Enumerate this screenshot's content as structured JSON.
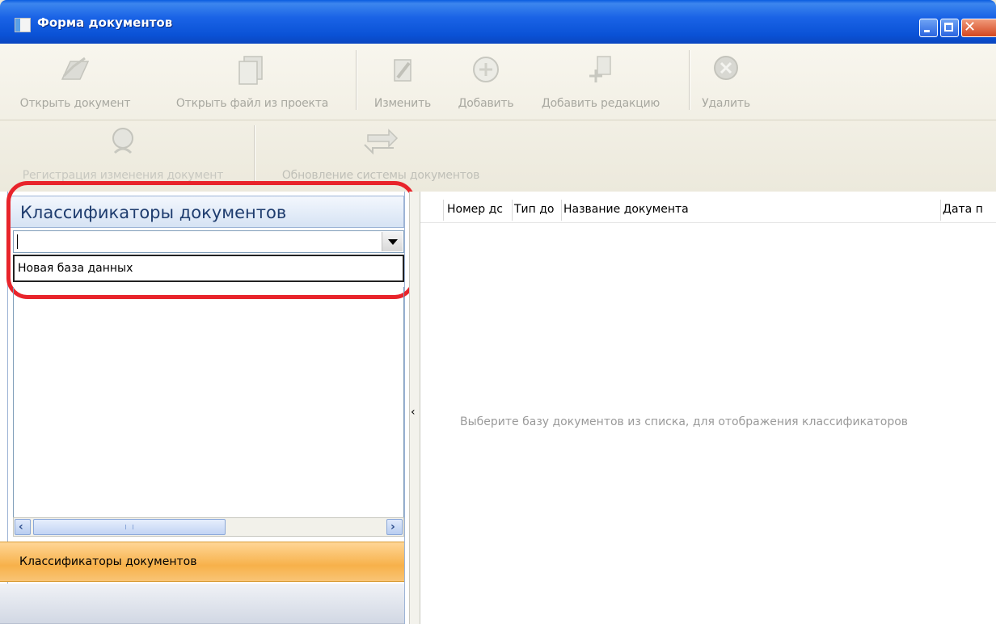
{
  "window": {
    "title": "Форма документов",
    "controls": [
      "minimize",
      "maximize",
      "close"
    ]
  },
  "toolbar": {
    "row1": [
      {
        "label": "Открыть документ",
        "icon": "open-document-icon"
      },
      {
        "label": "Открыть файл из проекта",
        "icon": "open-file-from-project-icon"
      },
      {
        "label": "Изменить",
        "icon": "edit-icon"
      },
      {
        "label": "Добавить",
        "icon": "add-icon"
      },
      {
        "label": "Добавить редакцию",
        "icon": "add-revision-icon"
      },
      {
        "label": "Удалить",
        "icon": "delete-icon"
      }
    ],
    "row2": [
      {
        "label": "Регистрация изменения документ",
        "icon": "register-change-icon"
      },
      {
        "label": "Обновление системы документов",
        "icon": "refresh-system-icon"
      }
    ]
  },
  "left_panel": {
    "header": "Классификаторы документов",
    "database_combo": {
      "value": ""
    },
    "dropdown_option": "Новая база данных",
    "nav_active": "Классификаторы документов"
  },
  "right_panel": {
    "columns": [
      "Номер дс",
      "Тип до",
      "Название документа",
      "Дата п"
    ],
    "empty_message": "Выберите базу документов из списка, для отображения классификаторов"
  },
  "colors": {
    "highlight": "#e8242b",
    "nav_active": "#f7b14a",
    "titlebar": "#0a52d6"
  }
}
